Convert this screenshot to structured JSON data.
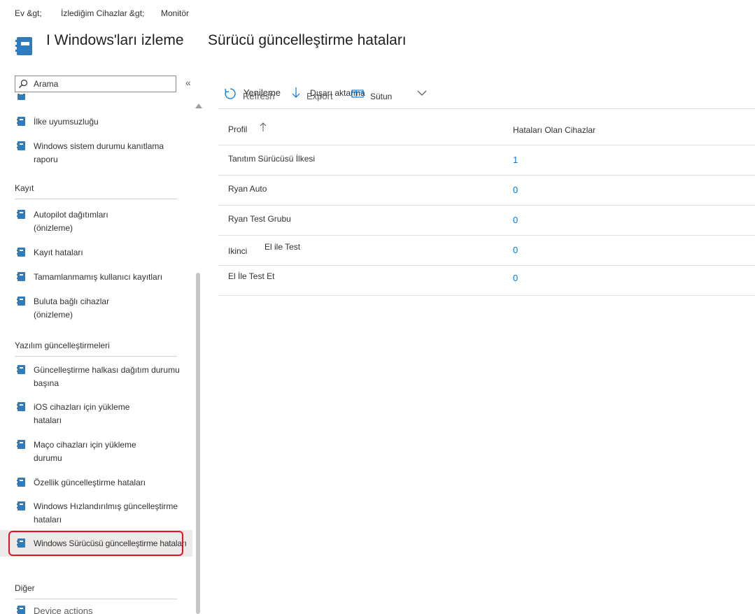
{
  "breadcrumb": {
    "home": "Ev &gt;",
    "devices": "İzlediğim Cihazlar &gt;",
    "monitor": "Monitör"
  },
  "page": {
    "title": "I Windows'ları izleme",
    "subtitle": "Sürücü güncelleştirme hataları"
  },
  "search": {
    "placeholder": "Arama"
  },
  "sidebar": {
    "items_top": [
      {
        "label": "İlke uyumsuzluğu"
      },
      {
        "label": "Windows sistem durumu kanıtlama raporu"
      }
    ],
    "section_enrollment": "Kayıt",
    "items_enrollment": [
      {
        "label": "Autopilot dağıtımları (önizleme)"
      },
      {
        "label": "Kayıt hataları"
      },
      {
        "label": "Tamamlanmamış kullanıcı kayıtları"
      },
      {
        "label": "Buluta bağlı cihazlar (önizleme)"
      }
    ],
    "section_updates": "Yazılım güncelleştirmeleri",
    "items_updates": [
      {
        "label": "Güncelleştirme halkası dağıtım durumu başına"
      },
      {
        "label": "iOS cihazları için yükleme hataları"
      },
      {
        "label": "Maço cihazları için yükleme durumu"
      },
      {
        "label": "Özellik güncelleştirme hataları"
      },
      {
        "label": "Windows Hızlandırılmış güncelleştirme hataları"
      },
      {
        "label": "Windows Sürücüsü güncelleştirme hataları"
      }
    ],
    "section_other": "Diğer",
    "items_other": [
      {
        "label": "Device actions"
      }
    ]
  },
  "toolbar": {
    "refresh_label": "Yenileme",
    "refresh_ghost": "Refresh",
    "export_label": "Dışarı aktarma",
    "export_ghost": "Export",
    "columns_label": "Sütun"
  },
  "table": {
    "headers": {
      "profile": "Profil",
      "devices": "Hataları Olan Cihazlar"
    },
    "rows": [
      {
        "profile": "Tanıtım Sürücüsü İlkesi",
        "count": "1"
      },
      {
        "profile": "Ryan Auto",
        "count": "0"
      },
      {
        "profile": "Ryan Test Grubu",
        "count": "0"
      },
      {
        "profile": "Ikinci",
        "extra": "El ile Test",
        "count": "0"
      },
      {
        "profile": "El İle Test Et",
        "count": "0"
      }
    ]
  },
  "colors": {
    "accent": "#0078d4",
    "highlight": "#e81123",
    "icon": "#2f7bbf"
  },
  "icons": [
    "notebook-icon",
    "search-icon",
    "collapse-icon",
    "refresh-icon",
    "download-icon",
    "columns-icon",
    "chevron-down-icon",
    "sort-ascending-icon"
  ]
}
